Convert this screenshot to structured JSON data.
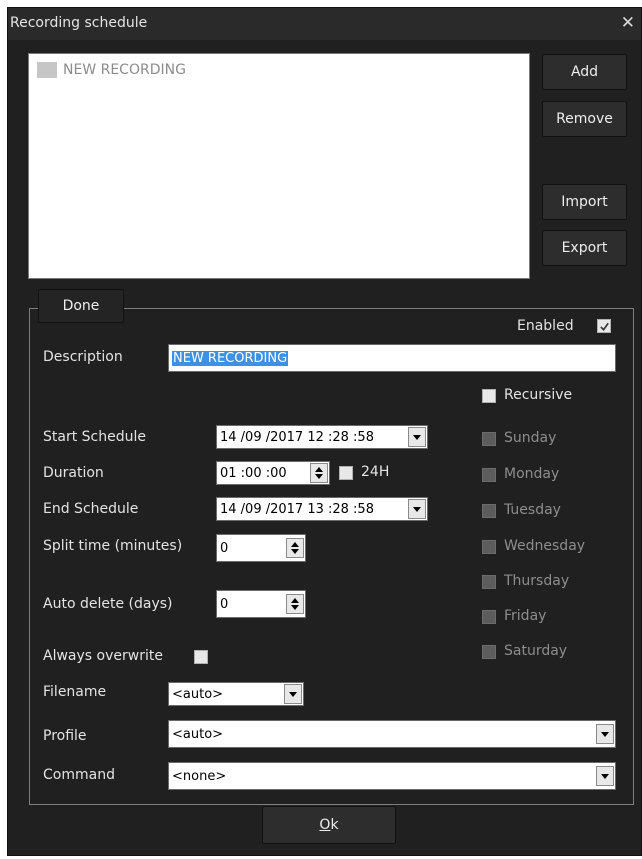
{
  "window": {
    "title": "Recording schedule"
  },
  "list": {
    "items": [
      "NEW RECORDING"
    ]
  },
  "side_buttons": {
    "add": "Add",
    "remove": "Remove",
    "import": "Import",
    "export": "Export"
  },
  "group": {
    "done": "Done",
    "enabled_label": "Enabled",
    "enabled": true
  },
  "description": {
    "label": "Description",
    "value": "NEW RECORDING"
  },
  "start": {
    "label": "Start Schedule",
    "value": "14 /09 /2017  12 :28 :58"
  },
  "duration": {
    "label": "Duration",
    "value": "01 :00 :00",
    "h24_label": "24H"
  },
  "end": {
    "label": "End Schedule",
    "value": "14 /09 /2017  13 :28 :58"
  },
  "split": {
    "label": "Split time (minutes)",
    "value": "0"
  },
  "auto_delete": {
    "label": "Auto delete (days)",
    "value": "0"
  },
  "overwrite": {
    "label": "Always overwrite"
  },
  "filename": {
    "label": "Filename",
    "value": "<auto>"
  },
  "profile": {
    "label": "Profile",
    "value": "<auto>"
  },
  "command": {
    "label": "Command",
    "value": "<none>"
  },
  "recursive": {
    "label": "Recursive"
  },
  "days": [
    "Sunday",
    "Monday",
    "Tuesday",
    "Wednesday",
    "Thursday",
    "Friday",
    "Saturday"
  ],
  "ok": {
    "prefix": "O",
    "rest": "k"
  },
  "colors": {
    "window_bg": "#202020",
    "selection": "#3c91e6"
  }
}
